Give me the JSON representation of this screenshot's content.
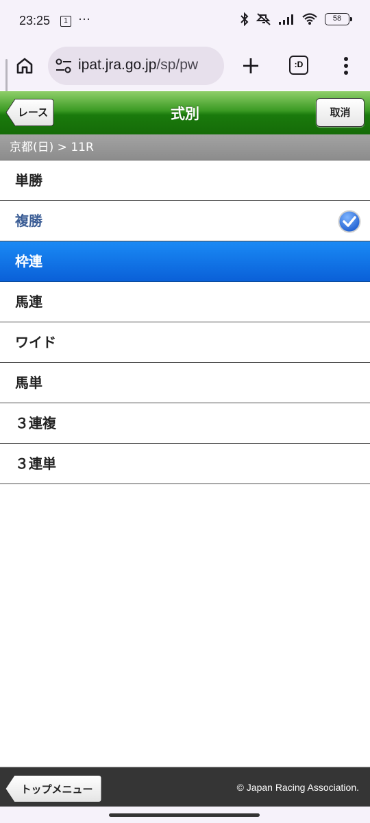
{
  "status_bar": {
    "time": "23:25",
    "notification_count": "1",
    "more": "···",
    "battery": "58",
    "icons": [
      "bluetooth-icon",
      "mute-icon",
      "signal-icon",
      "wifi-icon",
      "battery-icon"
    ]
  },
  "browser": {
    "url_host": "ipat.jra.go.jp",
    "url_path": "/sp/pw",
    "tabs_label": ":D",
    "icons": [
      "home-icon",
      "site-settings-icon",
      "plus-icon",
      "more-vert-icon"
    ]
  },
  "header": {
    "title": "式別",
    "back_label": "レース",
    "cancel_label": "取消",
    "color": "#1a7a0c"
  },
  "breadcrumb": {
    "text": "京都(日) > 11R"
  },
  "bet_types": [
    {
      "label": "単勝",
      "state": "normal"
    },
    {
      "label": "複勝",
      "state": "checked"
    },
    {
      "label": "枠連",
      "state": "active"
    },
    {
      "label": "馬連",
      "state": "normal"
    },
    {
      "label": "ワイド",
      "state": "normal"
    },
    {
      "label": "馬単",
      "state": "normal"
    },
    {
      "label": "３連複",
      "state": "normal"
    },
    {
      "label": "３連単",
      "state": "normal"
    }
  ],
  "colors": {
    "active_row": "#0a70e0",
    "checked_text": "#3b5d95"
  },
  "footer": {
    "top_menu_label": "トップメニュー",
    "copyright": "© Japan Racing Association."
  }
}
